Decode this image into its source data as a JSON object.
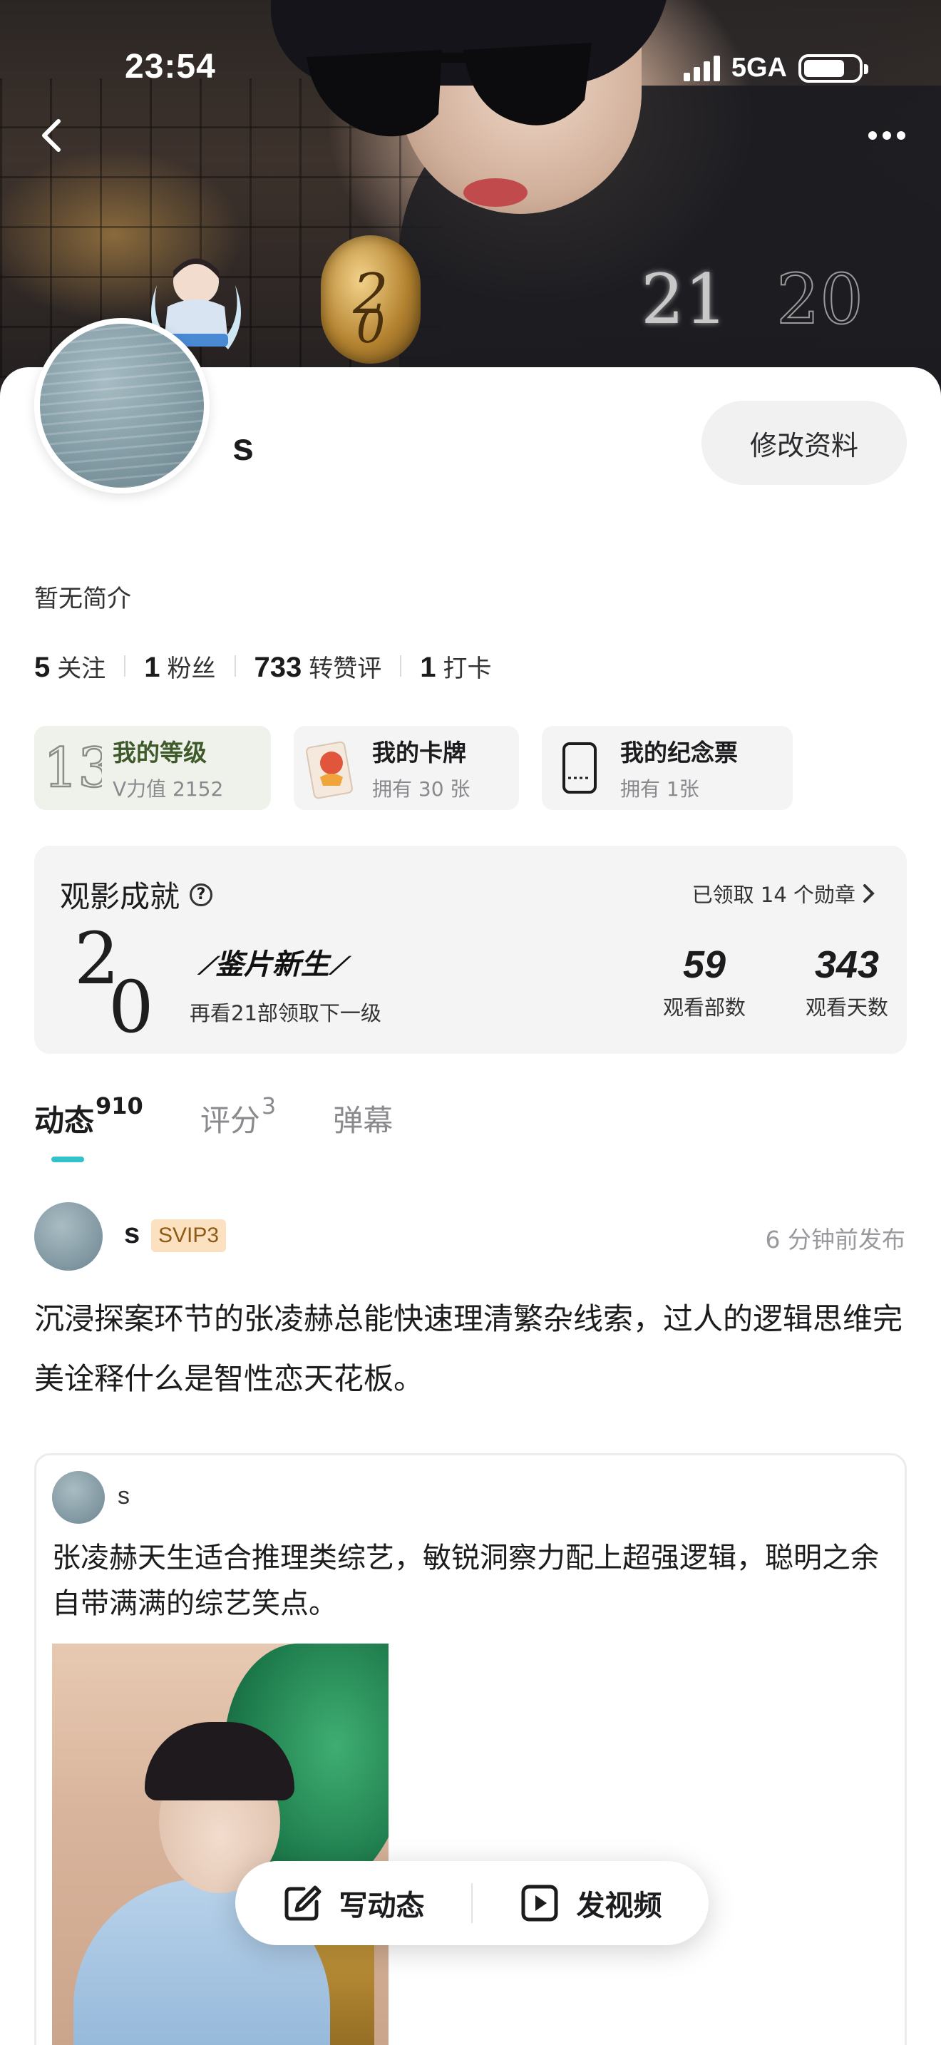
{
  "status_bar": {
    "time": "23:54",
    "network": "5GA",
    "battery_level": 0.75
  },
  "profile": {
    "username": "s",
    "edit_button": "修改资料",
    "bio": "暂无简介",
    "stats": [
      {
        "value": "5",
        "label": "关注"
      },
      {
        "value": "1",
        "label": "粉丝"
      },
      {
        "value": "733",
        "label": "转赞评"
      },
      {
        "value": "1",
        "label": "打卡"
      }
    ]
  },
  "quick_cards": {
    "level": {
      "title": "我的等级",
      "sub": "V力值 2152"
    },
    "cards": {
      "title": "我的卡牌",
      "sub": "拥有 30 张"
    },
    "ticket": {
      "title": "我的纪念票",
      "sub": "拥有 1张"
    }
  },
  "achievement": {
    "title": "观影成就",
    "link": "已领取 14 个勋章",
    "badge_name": "鉴片新生",
    "next_level": "再看21部领取下一级",
    "watched_count": "59",
    "watched_label": "观看部数",
    "days_count": "343",
    "days_label": "观看天数"
  },
  "tabs": [
    {
      "label": "动态",
      "count": "910",
      "active": true
    },
    {
      "label": "评分",
      "count": "3",
      "active": false
    },
    {
      "label": "弹幕",
      "count": "",
      "active": false
    }
  ],
  "post": {
    "user": "s",
    "vip": "SVIP3",
    "time": "6 分钟前发布",
    "text": "沉浸探案环节的张凌赫总能快速理清繁杂线索，过人的逻辑思维完美诠释什么是智性恋天花板。",
    "quote": {
      "user": "s",
      "text": "张凌赫天生适合推理类综艺，敏锐洞察力配上超强逻辑，聪明之余自带满满的综艺笑点。"
    }
  },
  "fab": {
    "write": "写动态",
    "video": "发视频"
  },
  "colors": {
    "accent": "#33c2c9",
    "vip_bg": "#fbe1bf",
    "level_text": "#3e5a2b"
  }
}
